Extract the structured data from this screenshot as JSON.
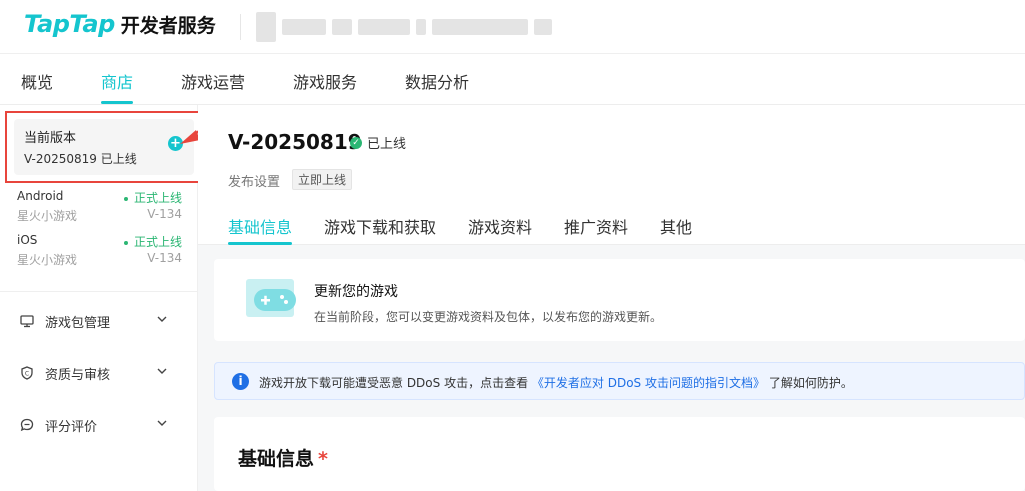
{
  "header": {
    "logo_text": "TapTap",
    "subtitle": "开发者服务"
  },
  "topnav": {
    "items": [
      "概览",
      "商店",
      "游戏运营",
      "游戏服务",
      "数据分析"
    ],
    "active": "商店"
  },
  "sidebar": {
    "current": {
      "title": "当前版本",
      "version": "V-20250819 已上线"
    },
    "platforms": [
      {
        "name": "Android",
        "status": "正式上线",
        "game": "星火小游戏",
        "version": "V-134"
      },
      {
        "name": "iOS",
        "status": "正式上线",
        "game": "星火小游戏",
        "version": "V-134"
      }
    ],
    "menu": [
      {
        "label": "游戏包管理",
        "icon": "monitor-icon"
      },
      {
        "label": "资质与审核",
        "icon": "certificate-icon"
      },
      {
        "label": "评分评价",
        "icon": "comment-icon"
      }
    ]
  },
  "main": {
    "version_title": "V-20250819",
    "status": "已上线",
    "publish_label": "发布设置",
    "publish_tag": "立即上线",
    "tabs": [
      "基础信息",
      "游戏下载和获取",
      "游戏资料",
      "推广资料",
      "其他"
    ],
    "active_tab": "基础信息",
    "update_card": {
      "title": "更新您的游戏",
      "desc": "在当前阶段，您可以变更游戏资料及包体，以发布您的游戏更新。"
    },
    "notice": {
      "text_before": "游戏开放下载可能遭受恶意 DDoS 攻击，点击查看",
      "link": "《开发者应对 DDoS 攻击问题的指引文档》",
      "text_after": "了解如何防护。"
    },
    "basic_title": "基础信息",
    "required_mark": "*"
  },
  "colors": {
    "accent": "#15c5ce",
    "success": "#2bb673",
    "highlight_border": "#e8453c",
    "info": "#1f6fe5"
  }
}
